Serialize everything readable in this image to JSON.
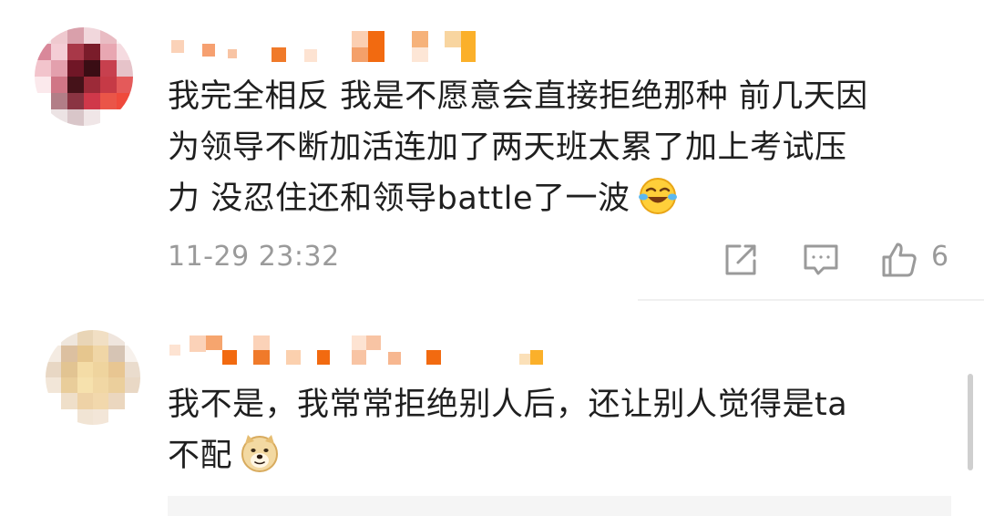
{
  "comments": [
    {
      "text_line1": "我完全相反 我是不愿意会直接拒绝那种 前几天因",
      "text_line2": "为领导不断加活连加了两天班太累了加上考试压",
      "text_line3": "力 没忍住还和领导battle了一波",
      "emoji": "laughing-crying-emoji",
      "timestamp": "11-29 23:32",
      "like_count": "6"
    },
    {
      "text_line1": "我不是，我常常拒绝别人后，还让别人觉得是ta",
      "text_line2": "不配",
      "emoji": "doge-emoji"
    }
  ],
  "icons": {
    "share": "share-icon",
    "reply": "comment-icon",
    "like": "thumbs-up-icon"
  },
  "colors": {
    "text": "#1f1f1f",
    "meta": "#9a9a9a",
    "username_blur": "#f07a2a"
  }
}
